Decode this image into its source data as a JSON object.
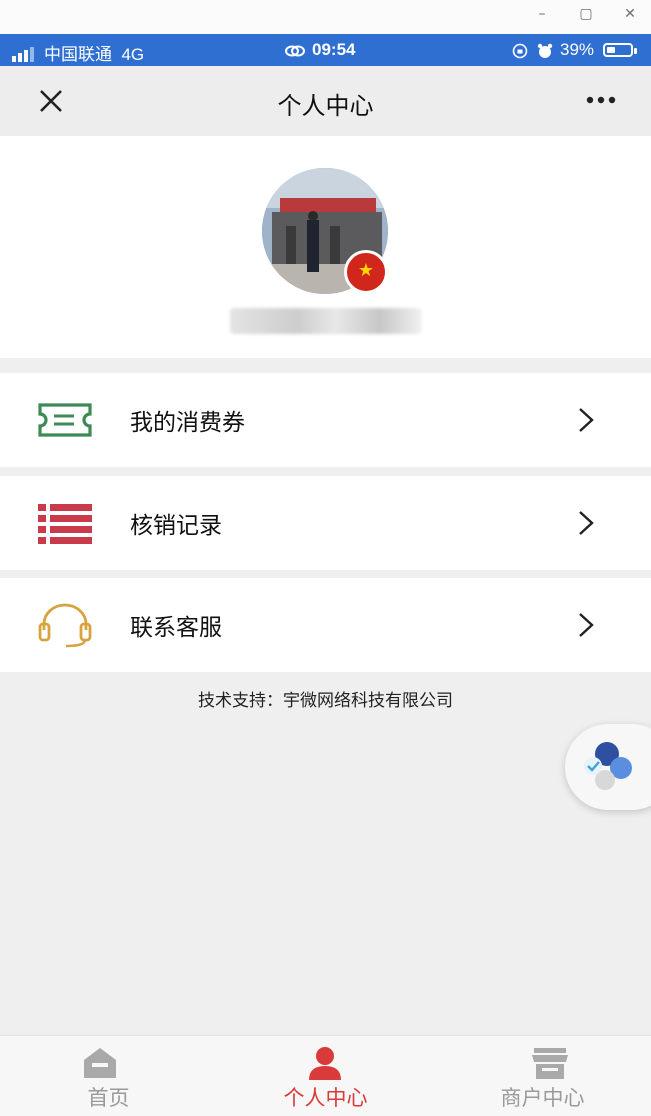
{
  "window": {
    "minimize": "–",
    "maximize": "▢",
    "close": "✕"
  },
  "status_bar": {
    "carrier": "中国联通",
    "network": "4G",
    "time": "09:54",
    "battery": "39%"
  },
  "navbar": {
    "title": "个人中心"
  },
  "menu": [
    {
      "label": "我的消费券",
      "icon": "ticket-icon",
      "color": "#3c8a55"
    },
    {
      "label": "核销记录",
      "icon": "list-icon",
      "color": "#c93b4b"
    },
    {
      "label": "联系客服",
      "icon": "headset-icon",
      "color": "#d8a23e"
    }
  ],
  "footer": {
    "text": "技术支持：宇微网络科技有限公司"
  },
  "tabbar": {
    "items": [
      {
        "label": "首页",
        "icon": "home-icon",
        "active": false
      },
      {
        "label": "个人中心",
        "icon": "person-icon",
        "active": true
      },
      {
        "label": "商户中心",
        "icon": "store-icon",
        "active": false
      }
    ],
    "active_color": "#d93a3a",
    "inactive_color": "#9a9a9a"
  }
}
